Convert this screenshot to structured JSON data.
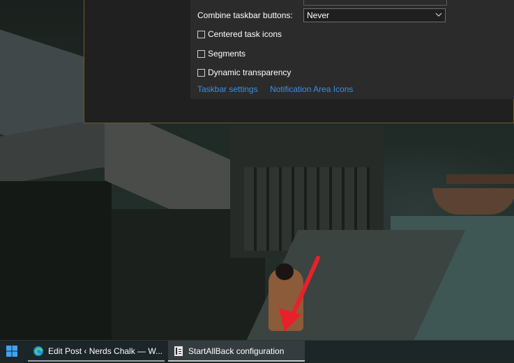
{
  "config_window": {
    "combine_label": "Combine taskbar buttons:",
    "combine_value": "Never",
    "options": [
      {
        "label": "Centered task icons",
        "checked": false
      },
      {
        "label": "Segments",
        "checked": false
      },
      {
        "label": "Dynamic transparency",
        "checked": false
      }
    ],
    "links": {
      "taskbar_settings": "Taskbar settings",
      "notification_area_icons": "Notification Area Icons"
    }
  },
  "taskbar": {
    "buttons": [
      {
        "label": "Edit Post ‹ Nerds Chalk — W...",
        "icon": "edge-icon",
        "active": false
      },
      {
        "label": "StartAllBack configuration",
        "icon": "startallback-icon",
        "active": true
      }
    ]
  },
  "colors": {
    "accent_link": "#3d8fde",
    "annotation_arrow": "#e8202a",
    "start_logo": "#3fa3f5"
  }
}
